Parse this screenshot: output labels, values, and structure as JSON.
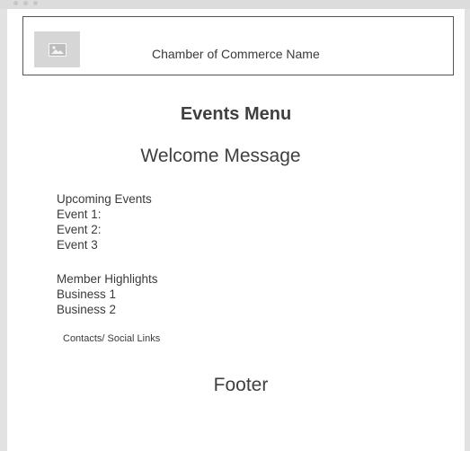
{
  "header": {
    "logo_icon": "image-placeholder-icon",
    "title": "Chamber of Commerce Name"
  },
  "main": {
    "heading": "Events Menu",
    "welcome": "Welcome Message",
    "upcoming": {
      "title": "Upcoming Events",
      "items": [
        "Event 1:",
        "Event 2:",
        "Event 3"
      ]
    },
    "highlights": {
      "title": "Member Highlights",
      "items": [
        "Business 1",
        "Business 2"
      ]
    },
    "contacts": "Contacts/ Social Links"
  },
  "footer": {
    "label": "Footer"
  }
}
